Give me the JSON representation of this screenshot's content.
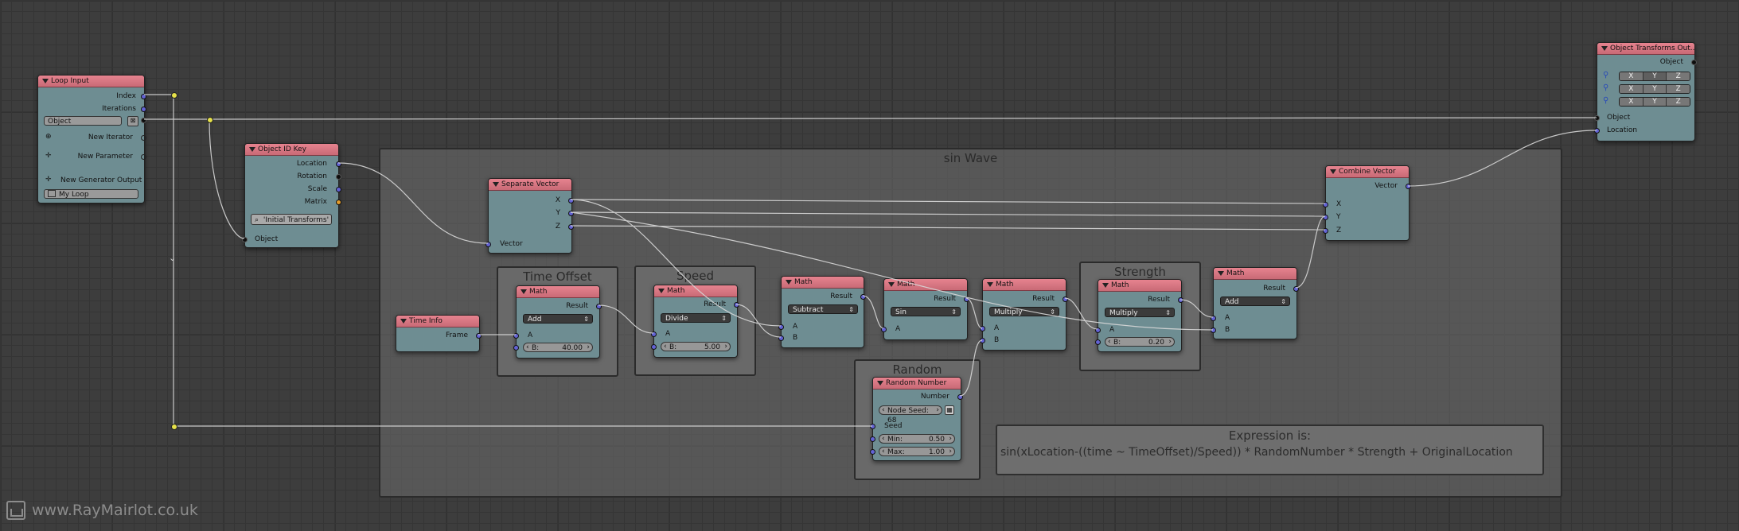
{
  "frames": {
    "sin_wave": "sin Wave",
    "time_offset": "Time Offset",
    "speed": "Speed",
    "strength": "Strength",
    "random": "Random"
  },
  "expression": {
    "title": "Expression is:",
    "text": "sin(xLocation-((time ~ TimeOffset)/Speed)) * RandomNumber * Strength + OriginalLocation"
  },
  "loop_input": {
    "title": "Loop Input",
    "index": "Index",
    "iterations": "Iterations",
    "object_field": "Object",
    "new_iterator": "New Iterator",
    "new_parameter": "New Parameter",
    "new_generator_output": "New Generator Output",
    "loop_name": "My Loop"
  },
  "object_id_key": {
    "title": "Object ID Key",
    "location": "Location",
    "rotation": "Rotation",
    "scale": "Scale",
    "matrix": "Matrix",
    "key_button": "'Initial Transforms'",
    "object": "Object"
  },
  "separate_vector": {
    "title": "Separate Vector",
    "x": "X",
    "y": "Y",
    "z": "Z",
    "vector": "Vector"
  },
  "time_info": {
    "title": "Time Info",
    "frame": "Frame"
  },
  "math_time_offset": {
    "title": "Math",
    "result": "Result",
    "op": "Add",
    "a": "A",
    "b_label": "B:",
    "b_value": "40.00"
  },
  "math_speed": {
    "title": "Math",
    "result": "Result",
    "op": "Divide",
    "a": "A",
    "b_label": "B:",
    "b_value": "5.00"
  },
  "math_subtract": {
    "title": "Math",
    "result": "Result",
    "op": "Subtract",
    "a": "A",
    "b": "B"
  },
  "math_sin": {
    "title": "Math",
    "result": "Result",
    "op": "Sin",
    "a": "A"
  },
  "math_multiply": {
    "title": "Math",
    "result": "Result",
    "op": "Multiply",
    "a": "A",
    "b": "B"
  },
  "math_strength": {
    "title": "Math",
    "result": "Result",
    "op": "Multiply",
    "a": "A",
    "b_label": "B:",
    "b_value": "0.20"
  },
  "math_add": {
    "title": "Math",
    "result": "Result",
    "op": "Add",
    "a": "A",
    "b": "B"
  },
  "random_number": {
    "title": "Random Number",
    "number": "Number",
    "node_seed": "Node Seed: 68",
    "seed": "Seed",
    "min_label": "Min:",
    "min_value": "0.50",
    "max_label": "Max:",
    "max_value": "1.00"
  },
  "combine_vector": {
    "title": "Combine Vector",
    "vector": "Vector",
    "x": "X",
    "y": "Y",
    "z": "Z"
  },
  "object_transforms_output": {
    "title": "Object Transforms Out...",
    "object_out": "Object",
    "rows": [
      [
        "X",
        "Y",
        "Z"
      ],
      [
        "X",
        "Y",
        "Z"
      ],
      [
        "X",
        "Y",
        "Z"
      ]
    ],
    "object_in": "Object",
    "location": "Location"
  },
  "watermark": "www.RayMairlot.co.uk",
  "colors": {
    "node_header": "#d9737f",
    "node_body": "#6e8d92",
    "vector_socket": "#6363d4",
    "object_socket": "#0d0d0d",
    "matrix_socket": "#e39c2b",
    "reroute": "#e6e14a",
    "grid_background": "#3d3d3d"
  }
}
